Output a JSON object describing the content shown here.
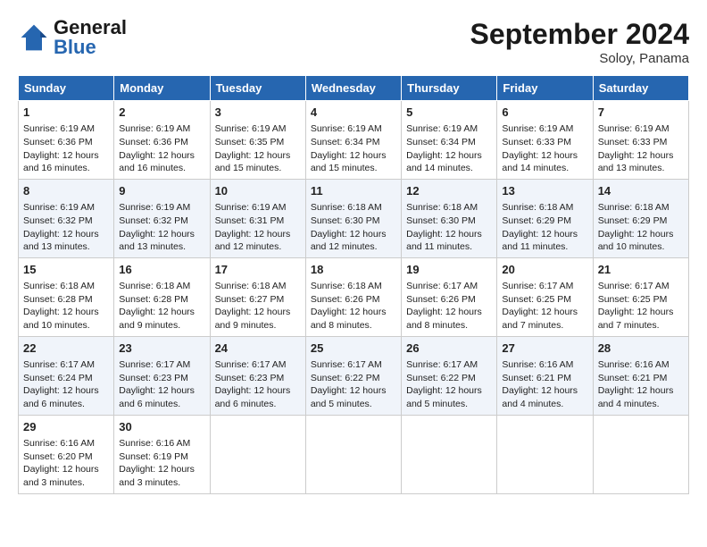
{
  "logo": {
    "name": "GeneralBlue",
    "part1": "General",
    "part2": "Blue"
  },
  "header": {
    "month": "September 2024",
    "location": "Soloy, Panama"
  },
  "days_of_week": [
    "Sunday",
    "Monday",
    "Tuesday",
    "Wednesday",
    "Thursday",
    "Friday",
    "Saturday"
  ],
  "weeks": [
    [
      {
        "day": 1,
        "sunrise": "Sunrise: 6:19 AM",
        "sunset": "Sunset: 6:36 PM",
        "daylight": "Daylight: 12 hours and 16 minutes."
      },
      {
        "day": 2,
        "sunrise": "Sunrise: 6:19 AM",
        "sunset": "Sunset: 6:36 PM",
        "daylight": "Daylight: 12 hours and 16 minutes."
      },
      {
        "day": 3,
        "sunrise": "Sunrise: 6:19 AM",
        "sunset": "Sunset: 6:35 PM",
        "daylight": "Daylight: 12 hours and 15 minutes."
      },
      {
        "day": 4,
        "sunrise": "Sunrise: 6:19 AM",
        "sunset": "Sunset: 6:34 PM",
        "daylight": "Daylight: 12 hours and 15 minutes."
      },
      {
        "day": 5,
        "sunrise": "Sunrise: 6:19 AM",
        "sunset": "Sunset: 6:34 PM",
        "daylight": "Daylight: 12 hours and 14 minutes."
      },
      {
        "day": 6,
        "sunrise": "Sunrise: 6:19 AM",
        "sunset": "Sunset: 6:33 PM",
        "daylight": "Daylight: 12 hours and 14 minutes."
      },
      {
        "day": 7,
        "sunrise": "Sunrise: 6:19 AM",
        "sunset": "Sunset: 6:33 PM",
        "daylight": "Daylight: 12 hours and 13 minutes."
      }
    ],
    [
      {
        "day": 8,
        "sunrise": "Sunrise: 6:19 AM",
        "sunset": "Sunset: 6:32 PM",
        "daylight": "Daylight: 12 hours and 13 minutes."
      },
      {
        "day": 9,
        "sunrise": "Sunrise: 6:19 AM",
        "sunset": "Sunset: 6:32 PM",
        "daylight": "Daylight: 12 hours and 13 minutes."
      },
      {
        "day": 10,
        "sunrise": "Sunrise: 6:19 AM",
        "sunset": "Sunset: 6:31 PM",
        "daylight": "Daylight: 12 hours and 12 minutes."
      },
      {
        "day": 11,
        "sunrise": "Sunrise: 6:18 AM",
        "sunset": "Sunset: 6:30 PM",
        "daylight": "Daylight: 12 hours and 12 minutes."
      },
      {
        "day": 12,
        "sunrise": "Sunrise: 6:18 AM",
        "sunset": "Sunset: 6:30 PM",
        "daylight": "Daylight: 12 hours and 11 minutes."
      },
      {
        "day": 13,
        "sunrise": "Sunrise: 6:18 AM",
        "sunset": "Sunset: 6:29 PM",
        "daylight": "Daylight: 12 hours and 11 minutes."
      },
      {
        "day": 14,
        "sunrise": "Sunrise: 6:18 AM",
        "sunset": "Sunset: 6:29 PM",
        "daylight": "Daylight: 12 hours and 10 minutes."
      }
    ],
    [
      {
        "day": 15,
        "sunrise": "Sunrise: 6:18 AM",
        "sunset": "Sunset: 6:28 PM",
        "daylight": "Daylight: 12 hours and 10 minutes."
      },
      {
        "day": 16,
        "sunrise": "Sunrise: 6:18 AM",
        "sunset": "Sunset: 6:28 PM",
        "daylight": "Daylight: 12 hours and 9 minutes."
      },
      {
        "day": 17,
        "sunrise": "Sunrise: 6:18 AM",
        "sunset": "Sunset: 6:27 PM",
        "daylight": "Daylight: 12 hours and 9 minutes."
      },
      {
        "day": 18,
        "sunrise": "Sunrise: 6:18 AM",
        "sunset": "Sunset: 6:26 PM",
        "daylight": "Daylight: 12 hours and 8 minutes."
      },
      {
        "day": 19,
        "sunrise": "Sunrise: 6:17 AM",
        "sunset": "Sunset: 6:26 PM",
        "daylight": "Daylight: 12 hours and 8 minutes."
      },
      {
        "day": 20,
        "sunrise": "Sunrise: 6:17 AM",
        "sunset": "Sunset: 6:25 PM",
        "daylight": "Daylight: 12 hours and 7 minutes."
      },
      {
        "day": 21,
        "sunrise": "Sunrise: 6:17 AM",
        "sunset": "Sunset: 6:25 PM",
        "daylight": "Daylight: 12 hours and 7 minutes."
      }
    ],
    [
      {
        "day": 22,
        "sunrise": "Sunrise: 6:17 AM",
        "sunset": "Sunset: 6:24 PM",
        "daylight": "Daylight: 12 hours and 6 minutes."
      },
      {
        "day": 23,
        "sunrise": "Sunrise: 6:17 AM",
        "sunset": "Sunset: 6:23 PM",
        "daylight": "Daylight: 12 hours and 6 minutes."
      },
      {
        "day": 24,
        "sunrise": "Sunrise: 6:17 AM",
        "sunset": "Sunset: 6:23 PM",
        "daylight": "Daylight: 12 hours and 6 minutes."
      },
      {
        "day": 25,
        "sunrise": "Sunrise: 6:17 AM",
        "sunset": "Sunset: 6:22 PM",
        "daylight": "Daylight: 12 hours and 5 minutes."
      },
      {
        "day": 26,
        "sunrise": "Sunrise: 6:17 AM",
        "sunset": "Sunset: 6:22 PM",
        "daylight": "Daylight: 12 hours and 5 minutes."
      },
      {
        "day": 27,
        "sunrise": "Sunrise: 6:16 AM",
        "sunset": "Sunset: 6:21 PM",
        "daylight": "Daylight: 12 hours and 4 minutes."
      },
      {
        "day": 28,
        "sunrise": "Sunrise: 6:16 AM",
        "sunset": "Sunset: 6:21 PM",
        "daylight": "Daylight: 12 hours and 4 minutes."
      }
    ],
    [
      {
        "day": 29,
        "sunrise": "Sunrise: 6:16 AM",
        "sunset": "Sunset: 6:20 PM",
        "daylight": "Daylight: 12 hours and 3 minutes."
      },
      {
        "day": 30,
        "sunrise": "Sunrise: 6:16 AM",
        "sunset": "Sunset: 6:19 PM",
        "daylight": "Daylight: 12 hours and 3 minutes."
      },
      null,
      null,
      null,
      null,
      null
    ]
  ]
}
